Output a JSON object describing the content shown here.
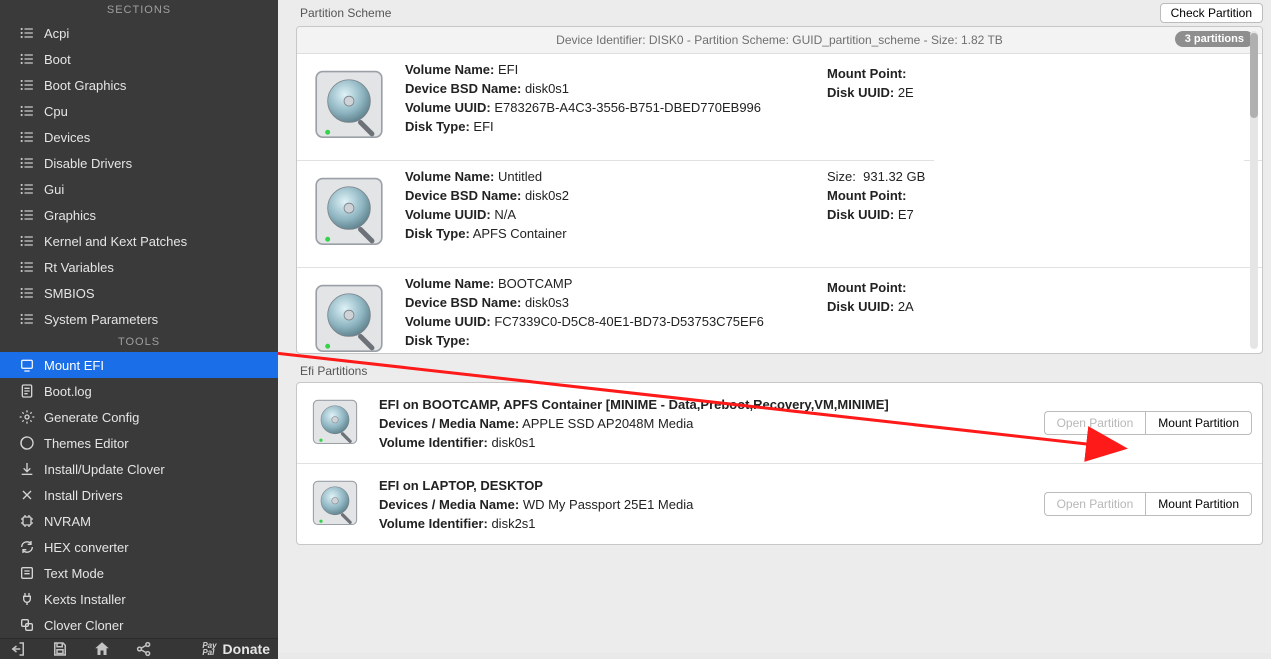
{
  "sidebar": {
    "sections_title": "SECTIONS",
    "tools_title": "TOOLS",
    "sections": [
      {
        "label": "Acpi",
        "icon": "list-icon"
      },
      {
        "label": "Boot",
        "icon": "list-icon"
      },
      {
        "label": "Boot Graphics",
        "icon": "list-icon"
      },
      {
        "label": "Cpu",
        "icon": "list-icon"
      },
      {
        "label": "Devices",
        "icon": "list-icon"
      },
      {
        "label": "Disable Drivers",
        "icon": "list-icon"
      },
      {
        "label": "Gui",
        "icon": "list-icon"
      },
      {
        "label": "Graphics",
        "icon": "list-icon"
      },
      {
        "label": "Kernel and Kext Patches",
        "icon": "list-icon"
      },
      {
        "label": "Rt Variables",
        "icon": "list-icon"
      },
      {
        "label": "SMBIOS",
        "icon": "list-icon"
      },
      {
        "label": "System Parameters",
        "icon": "list-icon"
      }
    ],
    "tools": [
      {
        "label": "Mount EFI",
        "icon": "mount-efi-icon",
        "selected": true
      },
      {
        "label": "Boot.log",
        "icon": "log-icon"
      },
      {
        "label": "Generate Config",
        "icon": "config-icon"
      },
      {
        "label": "Themes Editor",
        "icon": "themes-icon"
      },
      {
        "label": "Install/Update Clover",
        "icon": "download-icon"
      },
      {
        "label": "Install Drivers",
        "icon": "tools-icon"
      },
      {
        "label": "NVRAM",
        "icon": "chip-icon"
      },
      {
        "label": "HEX converter",
        "icon": "refresh-icon"
      },
      {
        "label": "Text Mode",
        "icon": "text-icon"
      },
      {
        "label": "Kexts Installer",
        "icon": "plug-icon"
      },
      {
        "label": "Clover Cloner",
        "icon": "clone-icon"
      }
    ],
    "bottom": {
      "donate_small": "Pay\nPal",
      "donate_label": "Donate"
    }
  },
  "toolbar": {
    "title": "Partition Scheme",
    "check_btn": "Check Partition"
  },
  "partition_header": {
    "text": "Device Identifier: DISK0 - Partition Scheme: GUID_partition_scheme - Size: 1.82 TB",
    "badge": "3 partitions"
  },
  "partitions": [
    {
      "volume_name_label": "Volume Name:",
      "volume_name": "EFI",
      "bsd_label": "Device BSD Name:",
      "bsd": "disk0s1",
      "uuid_label": "Volume UUID:",
      "uuid": "E783267B-A4C3-3556-B751-DBED770EB996",
      "disktype_label": "Disk Type:",
      "disktype": "EFI",
      "mount_label": "Mount Point:",
      "mount": "",
      "diskuuid_label": "Disk UUID:",
      "diskuuid": "2E",
      "size_label": "",
      "size": ""
    },
    {
      "volume_name_label": "Volume Name:",
      "volume_name": "Untitled",
      "bsd_label": "Device BSD Name:",
      "bsd": "disk0s2",
      "uuid_label": "Volume UUID:",
      "uuid": "N/A",
      "disktype_label": "Disk Type:",
      "disktype": "APFS Container",
      "mount_label": "Mount Point:",
      "mount": "",
      "diskuuid_label": "Disk UUID:",
      "diskuuid": "E7",
      "size_label": "Size:",
      "size": "931.32 GB"
    },
    {
      "volume_name_label": "Volume Name:",
      "volume_name": "BOOTCAMP",
      "bsd_label": "Device BSD Name:",
      "bsd": "disk0s3",
      "uuid_label": "Volume UUID:",
      "uuid": "FC7339C0-D5C8-40E1-BD73-D53753C75EF6",
      "disktype_label": "Disk Type:",
      "disktype": "",
      "mount_label": "Mount Point:",
      "mount": "",
      "diskuuid_label": "Disk UUID:",
      "diskuuid": "2A",
      "size_label": "",
      "size": ""
    }
  ],
  "efi_title": "Efi Partitions",
  "efi": [
    {
      "title": "EFI on BOOTCAMP, APFS Container [MINIME - Data,Preboot,Recovery,VM,MINIME]",
      "dm_label": "Devices / Media Name:",
      "dm": "APPLE SSD AP2048M Media",
      "vi_label": "Volume Identifier:",
      "vi": "disk0s1",
      "open_btn": "Open Partition",
      "mount_btn": "Mount Partition"
    },
    {
      "title": "EFI on LAPTOP, DESKTOP",
      "dm_label": "Devices / Media Name:",
      "dm": "WD My Passport 25E1 Media",
      "vi_label": "Volume Identifier:",
      "vi": "disk2s1",
      "open_btn": "Open Partition",
      "mount_btn": "Mount Partition"
    }
  ]
}
